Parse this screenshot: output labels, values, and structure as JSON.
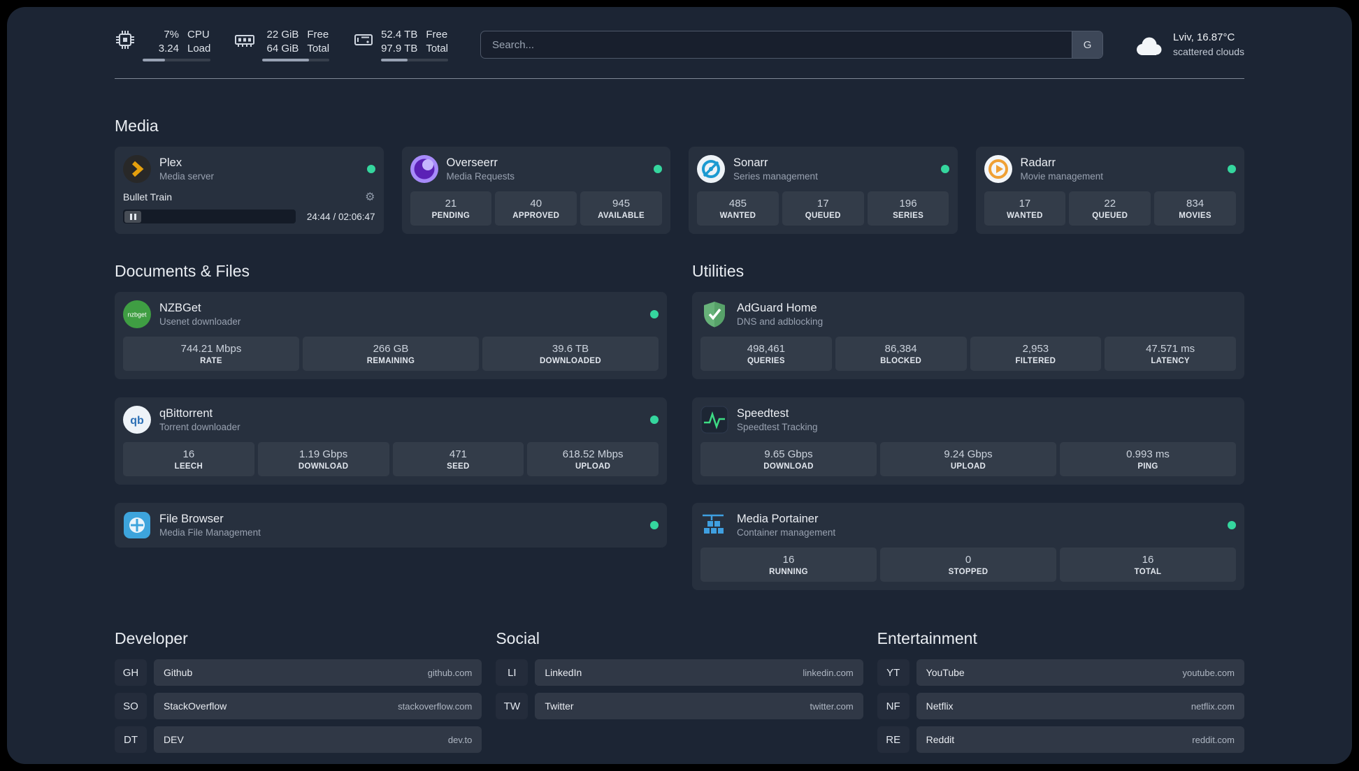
{
  "theme": {
    "background": "#1c2534",
    "card": "rgba(255,255,255,0.05)",
    "status_green": "#35d69e",
    "accent_amber": "#e5a00d"
  },
  "topbar": {
    "resources": [
      {
        "icon": "cpu-icon",
        "value_top": "7%",
        "value_bottom": "3.24",
        "label_top": "CPU",
        "label_bottom": "Load",
        "progress": 33
      },
      {
        "icon": "memory-icon",
        "value_top": "22 GiB",
        "value_bottom": "64 GiB",
        "label_top": "Free",
        "label_bottom": "Total",
        "progress": 70
      },
      {
        "icon": "disk-icon",
        "value_top": "52.4 TB",
        "value_bottom": "97.9 TB",
        "label_top": "Free",
        "label_bottom": "Total",
        "progress": 40
      }
    ],
    "search": {
      "placeholder": "Search...",
      "provider": "G"
    },
    "weather": {
      "location": "Lviv, 16.87°C",
      "condition": "scattered clouds"
    }
  },
  "sections": {
    "media": {
      "title": "Media",
      "plex": {
        "name": "Plex",
        "desc": "Media server",
        "now_playing": "Bullet Train",
        "time": "24:44 / 02:06:47"
      },
      "overseerr": {
        "name": "Overseerr",
        "desc": "Media Requests",
        "stats": [
          {
            "v": "21",
            "l": "PENDING"
          },
          {
            "v": "40",
            "l": "APPROVED"
          },
          {
            "v": "945",
            "l": "AVAILABLE"
          }
        ]
      },
      "sonarr": {
        "name": "Sonarr",
        "desc": "Series management",
        "stats": [
          {
            "v": "485",
            "l": "WANTED"
          },
          {
            "v": "17",
            "l": "QUEUED"
          },
          {
            "v": "196",
            "l": "SERIES"
          }
        ]
      },
      "radarr": {
        "name": "Radarr",
        "desc": "Movie management",
        "stats": [
          {
            "v": "17",
            "l": "WANTED"
          },
          {
            "v": "22",
            "l": "QUEUED"
          },
          {
            "v": "834",
            "l": "MOVIES"
          }
        ]
      }
    },
    "documents": {
      "title": "Documents & Files",
      "nzbget": {
        "name": "NZBGet",
        "desc": "Usenet downloader",
        "stats": [
          {
            "v": "744.21 Mbps",
            "l": "RATE"
          },
          {
            "v": "266 GB",
            "l": "REMAINING"
          },
          {
            "v": "39.6 TB",
            "l": "DOWNLOADED"
          }
        ]
      },
      "qbittorrent": {
        "name": "qBittorrent",
        "desc": "Torrent downloader",
        "stats": [
          {
            "v": "16",
            "l": "LEECH"
          },
          {
            "v": "1.19 Gbps",
            "l": "DOWNLOAD"
          },
          {
            "v": "471",
            "l": "SEED"
          },
          {
            "v": "618.52 Mbps",
            "l": "UPLOAD"
          }
        ]
      },
      "filebrowser": {
        "name": "File Browser",
        "desc": "Media File Management"
      }
    },
    "utilities": {
      "title": "Utilities",
      "adguard": {
        "name": "AdGuard Home",
        "desc": "DNS and adblocking",
        "stats": [
          {
            "v": "498,461",
            "l": "QUERIES"
          },
          {
            "v": "86,384",
            "l": "BLOCKED"
          },
          {
            "v": "2,953",
            "l": "FILTERED"
          },
          {
            "v": "47.571 ms",
            "l": "LATENCY"
          }
        ]
      },
      "speedtest": {
        "name": "Speedtest",
        "desc": "Speedtest Tracking",
        "stats": [
          {
            "v": "9.65 Gbps",
            "l": "DOWNLOAD"
          },
          {
            "v": "9.24 Gbps",
            "l": "UPLOAD"
          },
          {
            "v": "0.993 ms",
            "l": "PING"
          }
        ]
      },
      "portainer": {
        "name": "Media Portainer",
        "desc": "Container management",
        "stats": [
          {
            "v": "16",
            "l": "RUNNING"
          },
          {
            "v": "0",
            "l": "STOPPED"
          },
          {
            "v": "16",
            "l": "TOTAL"
          }
        ]
      }
    }
  },
  "bookmarks": [
    {
      "title": "Developer",
      "items": [
        {
          "abbr": "GH",
          "name": "Github",
          "url": "github.com"
        },
        {
          "abbr": "SO",
          "name": "StackOverflow",
          "url": "stackoverflow.com"
        },
        {
          "abbr": "DT",
          "name": "DEV",
          "url": "dev.to"
        }
      ]
    },
    {
      "title": "Social",
      "items": [
        {
          "abbr": "LI",
          "name": "LinkedIn",
          "url": "linkedin.com"
        },
        {
          "abbr": "TW",
          "name": "Twitter",
          "url": "twitter.com"
        }
      ]
    },
    {
      "title": "Entertainment",
      "items": [
        {
          "abbr": "YT",
          "name": "YouTube",
          "url": "youtube.com"
        },
        {
          "abbr": "NF",
          "name": "Netflix",
          "url": "netflix.com"
        },
        {
          "abbr": "RE",
          "name": "Reddit",
          "url": "reddit.com"
        }
      ]
    }
  ]
}
